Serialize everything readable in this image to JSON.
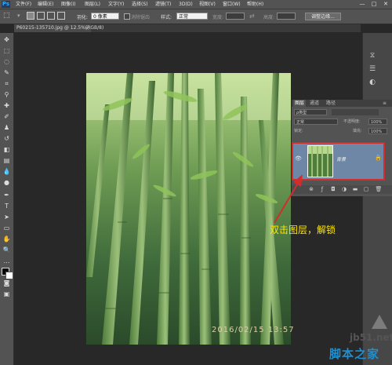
{
  "app": {
    "logo": "Ps"
  },
  "menu": [
    "文件(F)",
    "编辑(E)",
    "图像(I)",
    "图层(L)",
    "文字(Y)",
    "选择(S)",
    "滤镜(T)",
    "3D(D)",
    "视图(V)",
    "窗口(W)",
    "帮助(H)"
  ],
  "window_controls": [
    "—",
    "□",
    "✕"
  ],
  "options": {
    "feather_label": "羽化:",
    "feather_value": "0 像素",
    "antialias_label": "消除锯齿",
    "style_label": "样式:",
    "style_value": "正常",
    "width_label": "宽度:",
    "height_label": "高度:",
    "refine_edge": "调整边缘..."
  },
  "document": {
    "tab_title": "P60215-135710.jpg @ 12.5%(RGB/8)",
    "close": "×"
  },
  "photo": {
    "timestamp": "2016/02/15 13:57"
  },
  "layers_panel": {
    "tabs": [
      "图层",
      "通道",
      "路径"
    ],
    "active_tab": "图层",
    "kind_label": "ρ类型",
    "blend_mode": "正常",
    "opacity_label": "不透明度:",
    "opacity_value": "100%",
    "lock_label": "锁定:",
    "fill_label": "填充:",
    "fill_value": "100%",
    "layer_name": "背景"
  },
  "annotation": {
    "text": "双击图层，解锁",
    "color": "#ffe600"
  },
  "watermark": {
    "domain": "jb51.net",
    "name": "脚本之家"
  },
  "colors": {
    "highlight_border": "#d32c2c",
    "layer_selected": "#6e87a7"
  }
}
